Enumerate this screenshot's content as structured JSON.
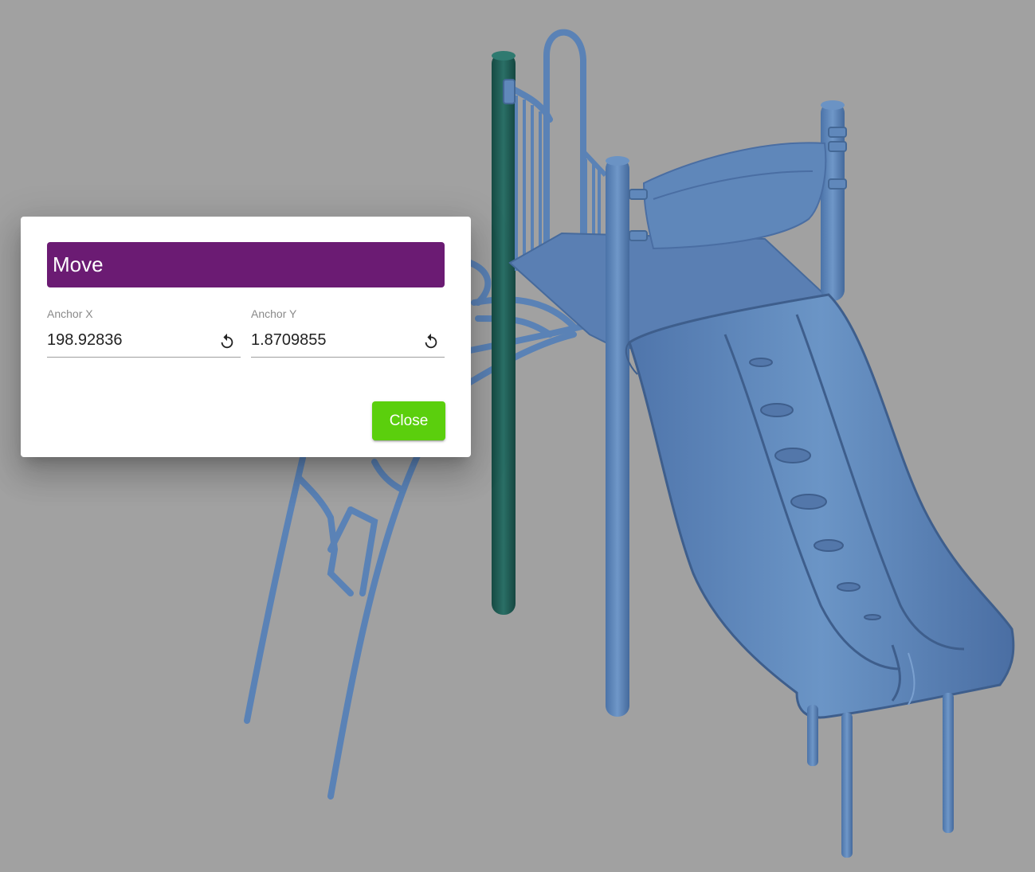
{
  "colors": {
    "background": "#a1a1a1",
    "title_bar": "#6b1b73",
    "close_button": "#5bcf0d",
    "model_blue": "#5a82b6",
    "model_dark": "#3e5e8c",
    "green_post": "#1f5d55"
  },
  "dialog": {
    "title": "Move",
    "anchor_x": {
      "label": "Anchor X",
      "value": "198.92836",
      "icon": "reset-icon"
    },
    "anchor_y": {
      "label": "Anchor Y",
      "value": "1.8709855",
      "icon": "reset-icon"
    },
    "close_label": "Close"
  },
  "scene": {
    "object": "playground-slide-model"
  }
}
